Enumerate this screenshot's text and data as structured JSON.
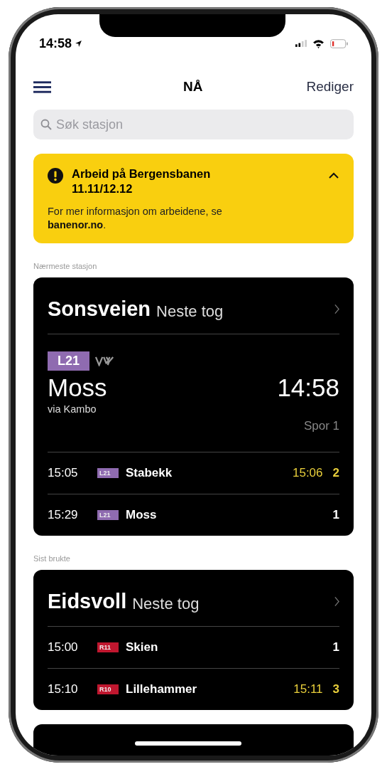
{
  "status_bar": {
    "time": "14:58"
  },
  "nav": {
    "title": "NÅ",
    "edit": "Rediger"
  },
  "search": {
    "placeholder": "Søk stasjon"
  },
  "alert": {
    "title": "Arbeid på Bergensbanen 11.11/12.12",
    "expanded": true,
    "text_before": "For mer informasjon om arbeidene, se",
    "link": "banenor.no",
    "text_after": "."
  },
  "sections": [
    {
      "label": "Nærmeste stasjon",
      "station": "Sonsveien",
      "subtitle": "Neste tog",
      "next": {
        "line": "L21",
        "color": "#8f6bb0",
        "destination": "Moss",
        "via": "via Kambo",
        "time": "14:58",
        "track": "Spor 1"
      },
      "departures": [
        {
          "time": "15:05",
          "line": "L21",
          "color": "#8f6bb0",
          "destination": "Stabekk",
          "new_time": "15:06",
          "track": "2",
          "delayed": true
        },
        {
          "time": "15:29",
          "line": "L21",
          "color": "#8f6bb0",
          "destination": "Moss",
          "track": "1",
          "delayed": false
        }
      ]
    },
    {
      "label": "Sist brukte",
      "station": "Eidsvoll",
      "subtitle": "Neste tog",
      "departures": [
        {
          "time": "15:00",
          "line": "R11",
          "color": "#c0172f",
          "destination": "Skien",
          "track": "1",
          "delayed": false
        },
        {
          "time": "15:10",
          "line": "R10",
          "color": "#c0172f",
          "destination": "Lillehammer",
          "new_time": "15:11",
          "track": "3",
          "delayed": true
        }
      ]
    }
  ]
}
